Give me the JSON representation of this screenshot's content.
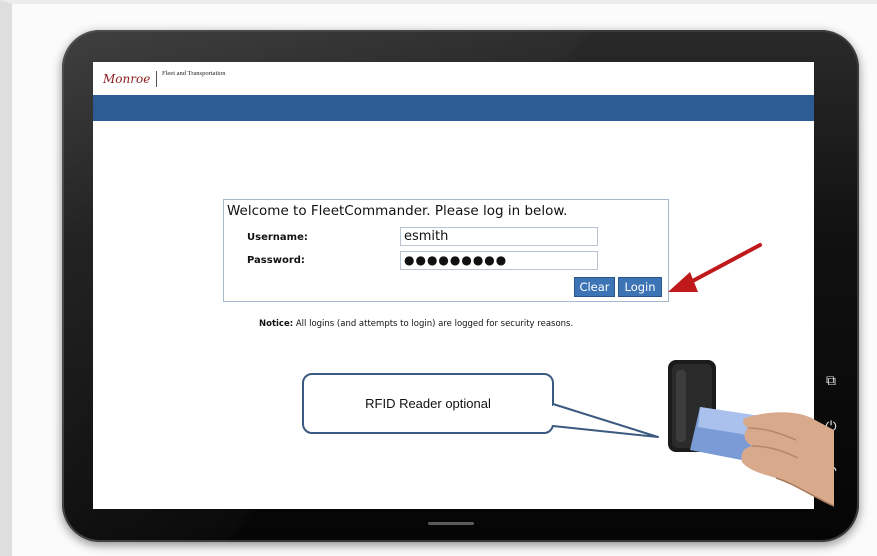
{
  "header": {
    "logo_name": "Monroe",
    "logo_subtitle": "Fleet and Transportation"
  },
  "login": {
    "welcome": "Welcome to FleetCommander. Please log in below.",
    "username_label": "Username:",
    "username_value": "esmith",
    "password_label": "Password:",
    "password_value": "●●●●●●●●●",
    "clear_label": "Clear",
    "login_label": "Login"
  },
  "notice": {
    "bold": "Notice:",
    "text": "All logins (and attempts to login) are logged for security reasons."
  },
  "callout": {
    "text": "RFID Reader optional"
  },
  "colors": {
    "header_bar": "#2d5c95",
    "button": "#3d74b5",
    "arrow": "#c0191c",
    "callout_border": "#3a5a80"
  },
  "icons": {
    "side_buttons": [
      "recent-apps-icon",
      "power-icon",
      "back-icon"
    ]
  }
}
